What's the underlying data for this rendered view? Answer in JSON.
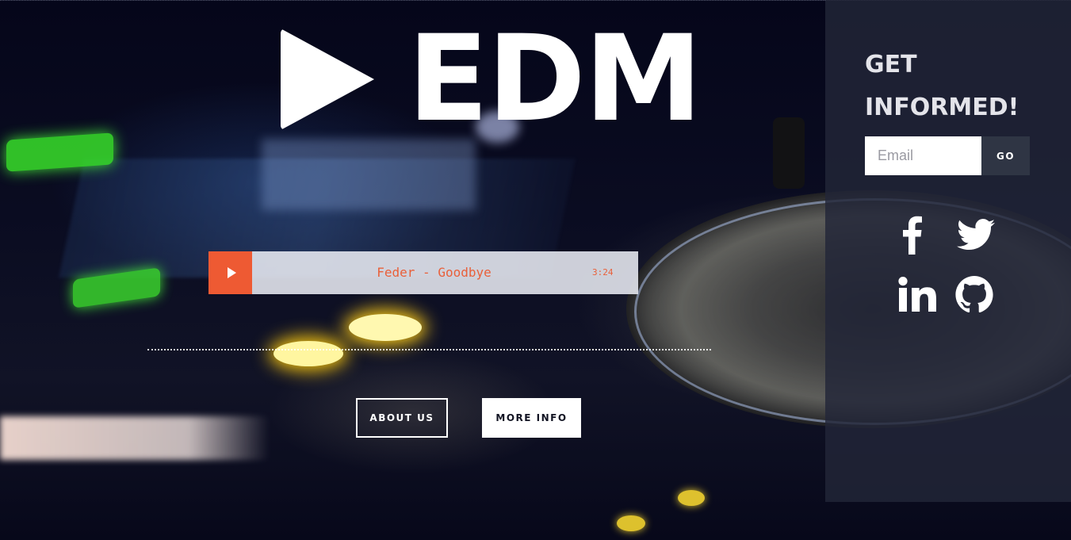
{
  "brand": {
    "logo_icon": "play-icon",
    "name": "EDM"
  },
  "player": {
    "play_icon": "play-icon",
    "track_title": "Feder - Goodbye",
    "duration": "3:24"
  },
  "actions": {
    "about_label": "ABOUT US",
    "more_label": "MORE INFO"
  },
  "signup": {
    "heading": "GET INFORMED!",
    "email_placeholder": "Email",
    "go_label": "GO"
  },
  "social": [
    {
      "icon": "facebook-icon"
    },
    {
      "icon": "twitter-icon"
    },
    {
      "icon": "linkedin-icon"
    },
    {
      "icon": "github-icon"
    }
  ],
  "colors": {
    "accent": "#ee5a33",
    "panel": "#222638",
    "text": "#ffffff"
  }
}
